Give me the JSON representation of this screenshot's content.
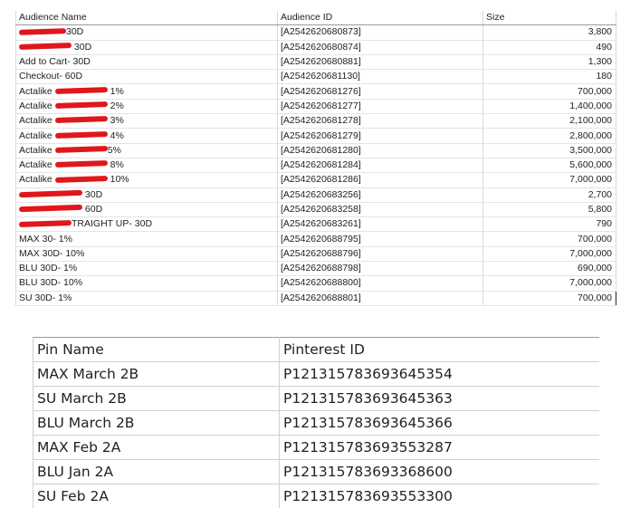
{
  "audience_table": {
    "headers": {
      "name": "Audience Name",
      "id": "Audience ID",
      "size": "Size"
    },
    "rows": [
      {
        "prefix": "",
        "suffix": "30D",
        "id": "[A2542620680873]",
        "size": "3,800"
      },
      {
        "prefix": "",
        "suffix": " 30D",
        "id": "[A2542620680874]",
        "size": "490"
      },
      {
        "prefix": "Add to Cart- 30D",
        "suffix": "",
        "id": "[A2542620680881]",
        "size": "1,300"
      },
      {
        "prefix": "Checkout- 60D",
        "suffix": "",
        "id": "[A2542620681130]",
        "size": "180"
      },
      {
        "prefix": "Actalike ",
        "suffix": " 1%",
        "id": "[A2542620681276]",
        "size": "700,000"
      },
      {
        "prefix": "Actalike ",
        "suffix": " 2%",
        "id": "[A2542620681277]",
        "size": "1,400,000"
      },
      {
        "prefix": "Actalike ",
        "suffix": " 3%",
        "id": "[A2542620681278]",
        "size": "2,100,000"
      },
      {
        "prefix": "Actalike ",
        "suffix": " 4%",
        "id": "[A2542620681279]",
        "size": "2,800,000"
      },
      {
        "prefix": "Actalike ",
        "suffix": "5%",
        "id": "[A2542620681280]",
        "size": "3,500,000"
      },
      {
        "prefix": "Actalike ",
        "suffix": " 8%",
        "id": "[A2542620681284]",
        "size": "5,600,000"
      },
      {
        "prefix": "Actalike ",
        "suffix": " 10%",
        "id": "[A2542620681286]",
        "size": "7,000,000"
      },
      {
        "prefix": "",
        "suffix": " 30D",
        "id": "[A2542620683256]",
        "size": "2,700"
      },
      {
        "prefix": "",
        "suffix": " 60D",
        "id": "[A2542620683258]",
        "size": "5,800"
      },
      {
        "prefix": "",
        "suffix": "TRAIGHT UP- 30D",
        "id": "[A2542620683261]",
        "size": "790"
      },
      {
        "prefix": "MAX 30- 1%",
        "suffix": "",
        "id": "[A2542620688795]",
        "size": "700,000"
      },
      {
        "prefix": "MAX 30D- 10%",
        "suffix": "",
        "id": "[A2542620688796]",
        "size": "7,000,000"
      },
      {
        "prefix": "BLU 30D- 1%",
        "suffix": "",
        "id": "[A2542620688798]",
        "size": "690,000"
      },
      {
        "prefix": "BLU 30D- 10%",
        "suffix": "",
        "id": "[A2542620688800]",
        "size": "7,000,000"
      },
      {
        "prefix": "SU 30D- 1%",
        "suffix": "",
        "id": "[A2542620688801]",
        "size": "700,000"
      }
    ]
  },
  "pin_table": {
    "headers": {
      "name": "Pin Name",
      "id": "Pinterest ID"
    },
    "rows": [
      {
        "name": "MAX March 2B",
        "id": "P121315783693645354"
      },
      {
        "name": "SU March 2B",
        "id": "P121315783693645363"
      },
      {
        "name": "BLU March 2B",
        "id": "P121315783693645366"
      },
      {
        "name": "MAX Feb 2A",
        "id": "P121315783693553287"
      },
      {
        "name": "BLU Jan 2A",
        "id": "P121315783693368600"
      },
      {
        "name": "SU Feb 2A",
        "id": "P121315783693553300"
      }
    ]
  },
  "colors": {
    "redaction": "#e0171b",
    "text": "#222222",
    "grid": "#d8d8d8"
  }
}
